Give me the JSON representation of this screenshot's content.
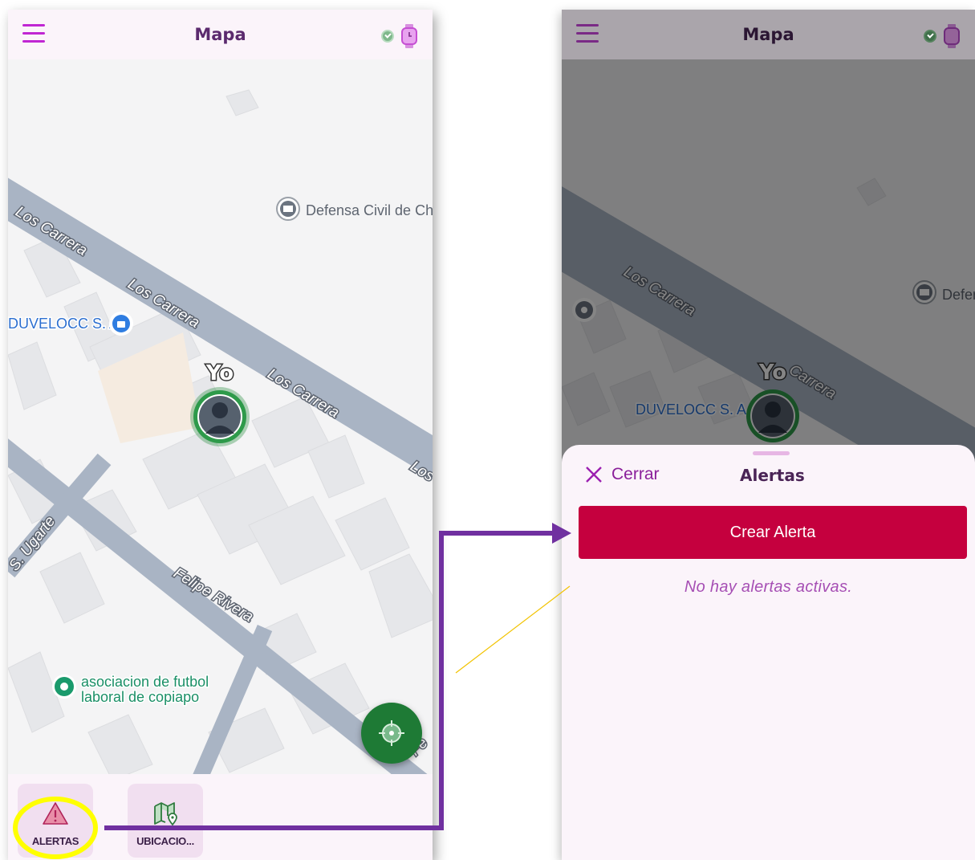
{
  "colors": {
    "accent": "#c026d3",
    "title": "#5b2a6e",
    "primary_button": "#c5003e",
    "fab": "#1e7a35",
    "annotation_arrow": "#7030a0",
    "annotation_circle": "#ffff00"
  },
  "left_screen": {
    "header": {
      "title": "Mapa",
      "menu_icon": "hamburger-menu-icon",
      "status_icon": "check-circle-icon",
      "device_icon": "smartwatch-icon"
    },
    "map": {
      "streets": [
        "Los Carrera",
        "Los Carrera",
        "Los Carrera",
        "Los",
        "Los Carrera",
        "Felipe Rivera",
        "S. Ugarte",
        "Fe"
      ],
      "places": [
        {
          "name": "Defensa Civil de Ch",
          "icon": "government-pin-icon"
        },
        {
          "name": "DUVELOCC S. A",
          "icon": "shop-pin-icon"
        },
        {
          "name_line1": "asociacion de futbol",
          "name_line2": "laboral de copiapo",
          "icon": "place-pin-icon"
        }
      ],
      "user_marker_label": "Yo"
    },
    "locate_button_icon": "crosshair-icon",
    "bottom_nav": [
      {
        "label": "ALERTAS",
        "icon": "warning-triangle-icon"
      },
      {
        "label": "UBICACIO...",
        "icon": "map-pin-icon"
      }
    ]
  },
  "right_screen": {
    "header": {
      "title": "Mapa"
    },
    "map": {
      "streets": [
        "Los Carrera",
        "Carrera"
      ],
      "places": [
        {
          "name": "Defer",
          "icon": "government-pin-icon"
        },
        {
          "name": "DUVELOCC S. A",
          "icon": "shop-pin-icon"
        }
      ],
      "user_marker_label": "Yo"
    },
    "sheet": {
      "close_label": "Cerrar",
      "title": "Alertas",
      "create_button": "Crear Alerta",
      "empty_message": "No hay alertas activas."
    }
  }
}
